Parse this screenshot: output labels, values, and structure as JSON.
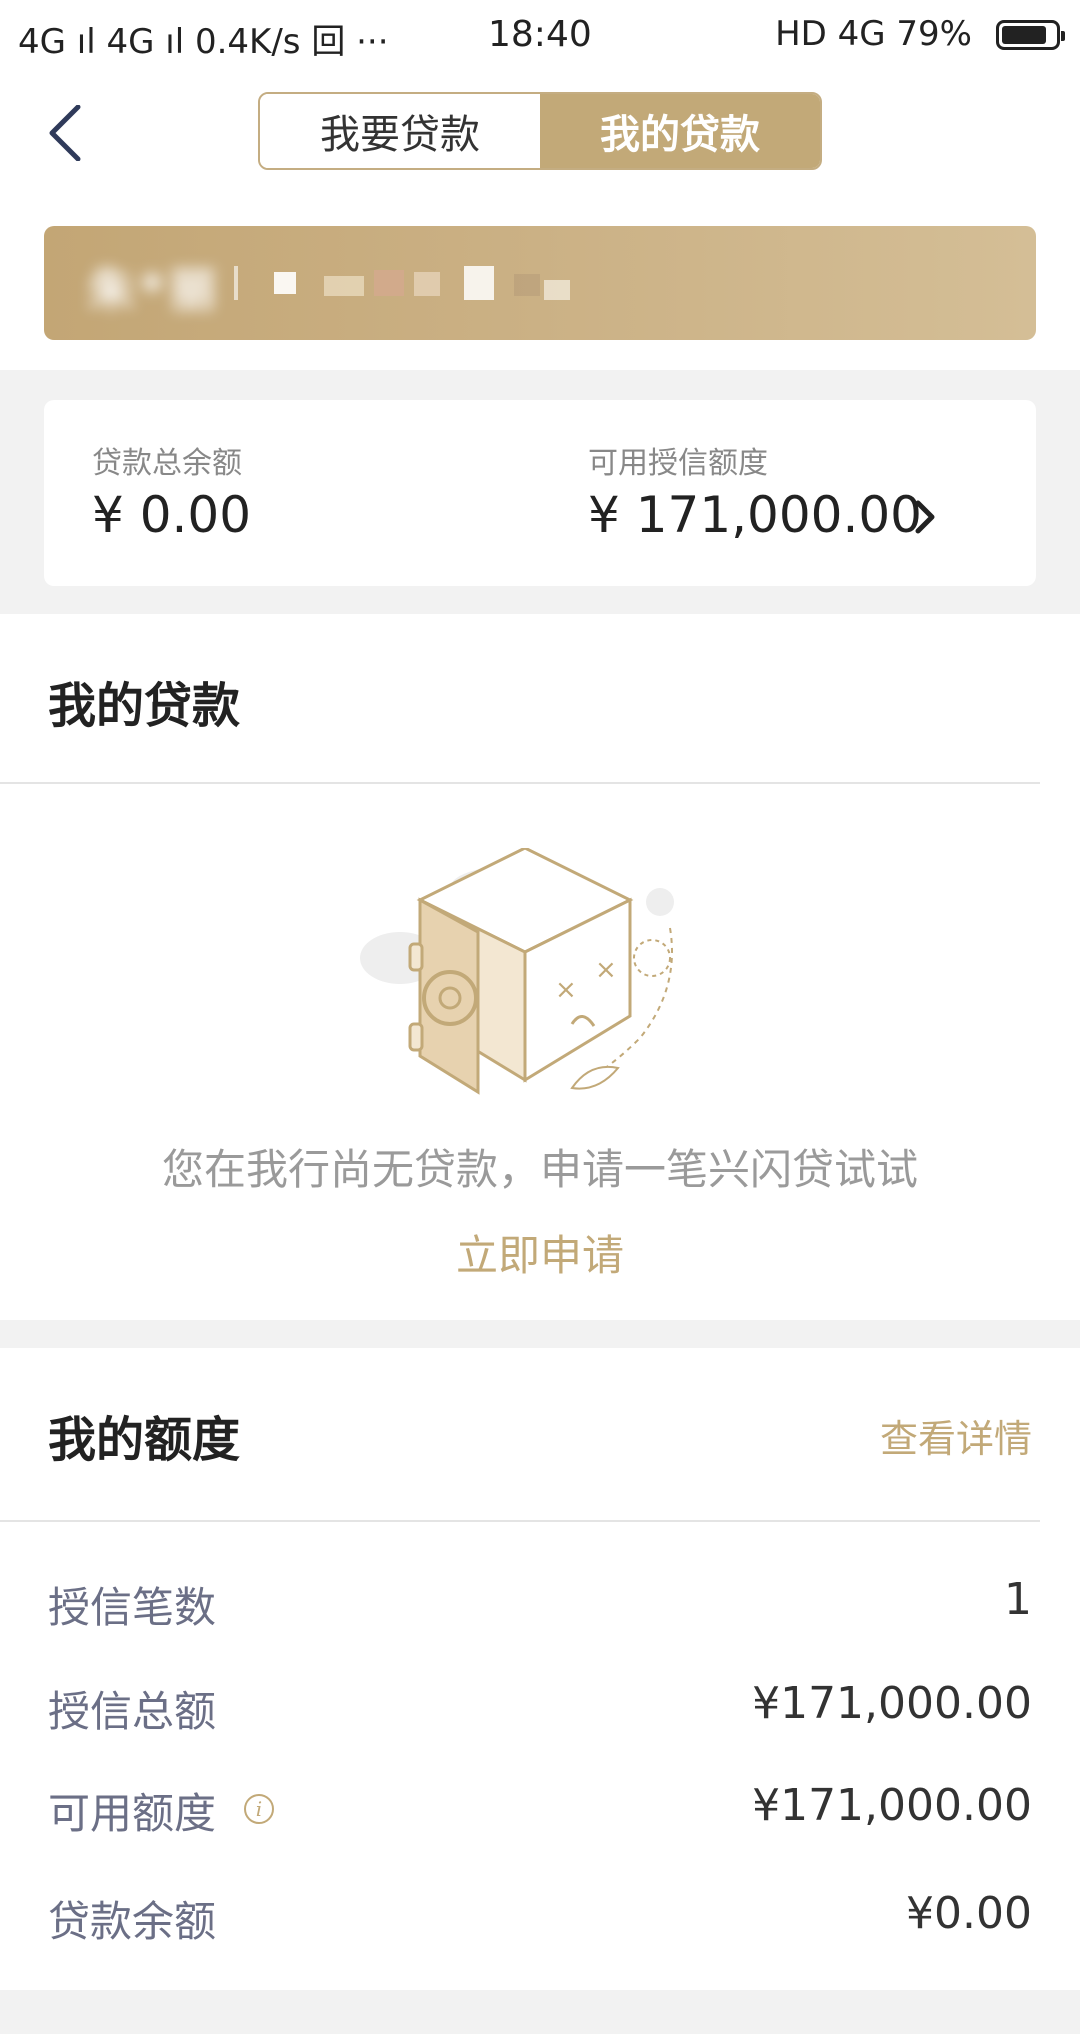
{
  "status_bar": {
    "left": "4G ıl 4G ıl 0.4K/s 回 ···",
    "time": "18:40",
    "right": "HD 4G 79%"
  },
  "header": {
    "back_icon": "back-arrow-icon",
    "tabs": [
      {
        "label": "我要贷款",
        "active": false
      },
      {
        "label": "我的贷款",
        "active": true
      }
    ]
  },
  "banner": {
    "name": "朱*丽"
  },
  "summary": {
    "total_balance_label": "贷款总余额",
    "total_balance_value": "¥ 0.00",
    "available_credit_label": "可用授信额度",
    "available_credit_value": "¥ 171,000.00"
  },
  "my_loans": {
    "title": "我的贷款",
    "empty_text": "您在我行尚无贷款，申请一笔兴闪贷试试",
    "apply_label": "立即申请"
  },
  "my_quota": {
    "title": "我的额度",
    "detail_label": "查看详情",
    "rows": [
      {
        "label": "授信笔数",
        "value": "1"
      },
      {
        "label": "授信总额",
        "value": "¥171,000.00"
      },
      {
        "label": "可用额度",
        "value": "¥171,000.00"
      },
      {
        "label": "贷款余额",
        "value": "¥0.00"
      }
    ]
  },
  "colors": {
    "accent_gold": "#c2a978",
    "label_gray": "#6b6f86"
  }
}
